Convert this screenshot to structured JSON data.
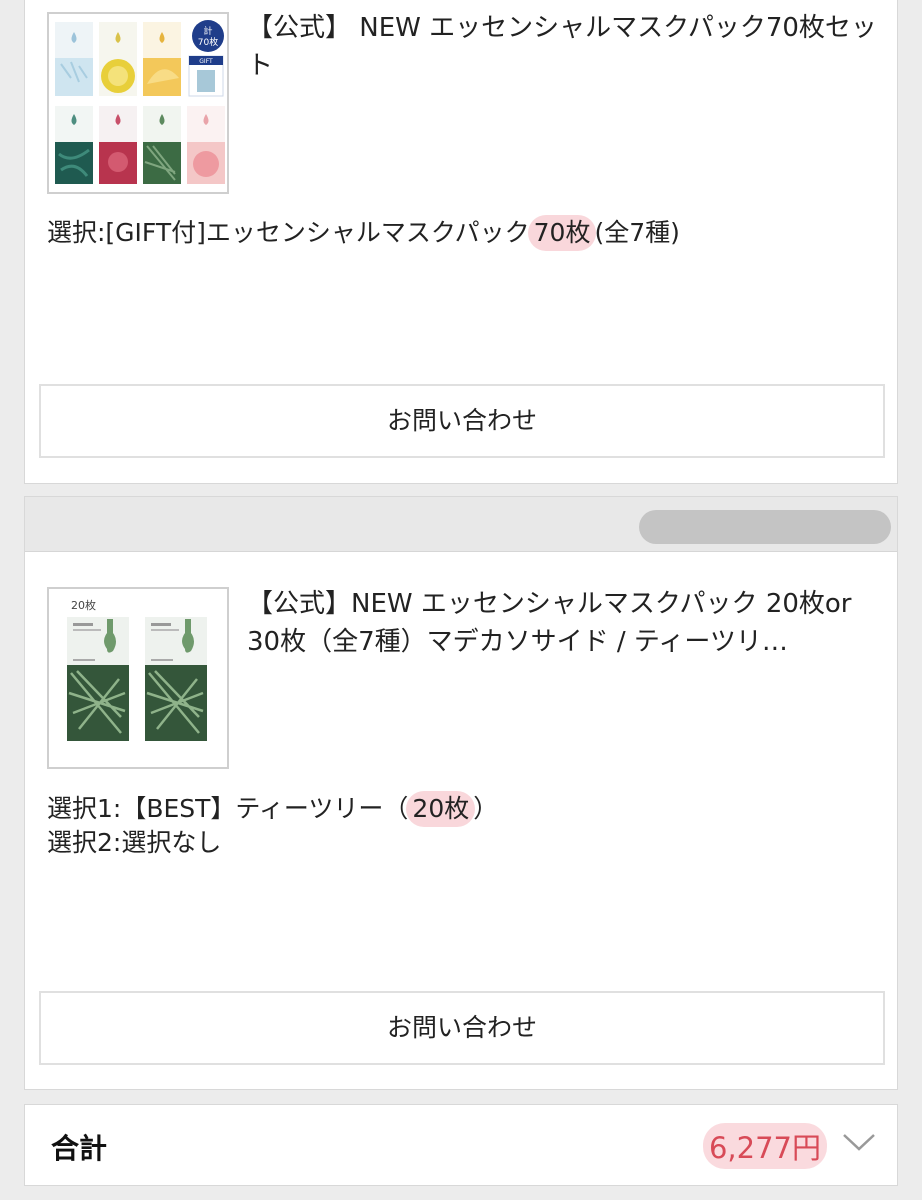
{
  "items": [
    {
      "title": "【公式】 NEW エッセンシャルマスクパック70枚セット",
      "option_line": {
        "prefix": "選択:[GIFT付]エッセンシャルマスクパック",
        "highlight": "70枚",
        "suffix": "(全7種)"
      },
      "image": {
        "badge_top": "計",
        "badge_bottom": "70枚",
        "tag": "GIFT"
      },
      "button_label": "お問い合わせ"
    },
    {
      "title": "【公式】NEW エッセンシャルマスクパック 20枚or 30枚（全7種）マデカソサイド / ティーツリ…",
      "option_line_1": {
        "prefix": "選択1:【BEST】ティーツリー（",
        "highlight": "20枚",
        "suffix": "）"
      },
      "option_line_2": "選択2:選択なし",
      "image": {
        "count_label": "20枚"
      },
      "button_label": "お問い合わせ"
    }
  ],
  "total": {
    "label": "合計",
    "price": "6,277円"
  },
  "colors": {
    "price_red": "#d84a57",
    "highlight_pink": "#f3a1aa"
  },
  "icons": {
    "expand": "chevron-down-icon"
  }
}
